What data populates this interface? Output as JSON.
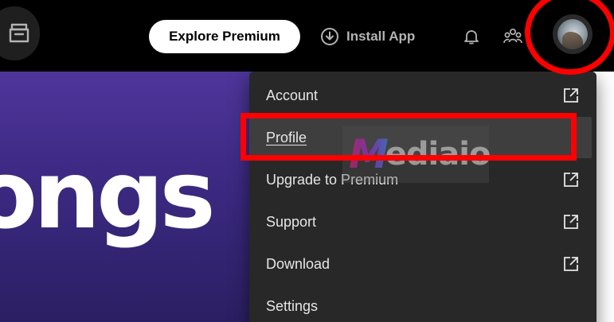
{
  "topbar": {
    "explore_premium_label": "Explore Premium",
    "install_app_label": "Install App",
    "icons": [
      "browse-icon",
      "download-circle-icon",
      "bell-icon",
      "friends-icon",
      "avatar"
    ]
  },
  "hero": {
    "visible_text": "ongs"
  },
  "account_menu": {
    "items": [
      {
        "label": "Account",
        "external": true
      },
      {
        "label": "Profile",
        "external": false,
        "highlighted": true
      },
      {
        "label": "Upgrade to Premium",
        "external": true
      },
      {
        "label": "Support",
        "external": true
      },
      {
        "label": "Download",
        "external": true
      },
      {
        "label": "Settings",
        "external": false
      }
    ]
  },
  "watermark": {
    "mark": "M",
    "text": "ediaio"
  },
  "colors": {
    "topbar_bg": "#000000",
    "menu_bg": "#282828",
    "menu_active_bg": "#3e3e3e",
    "hero_purple": "#4f359b",
    "highlight_red": "#ff0000",
    "text_light": "#e6e6e6"
  }
}
